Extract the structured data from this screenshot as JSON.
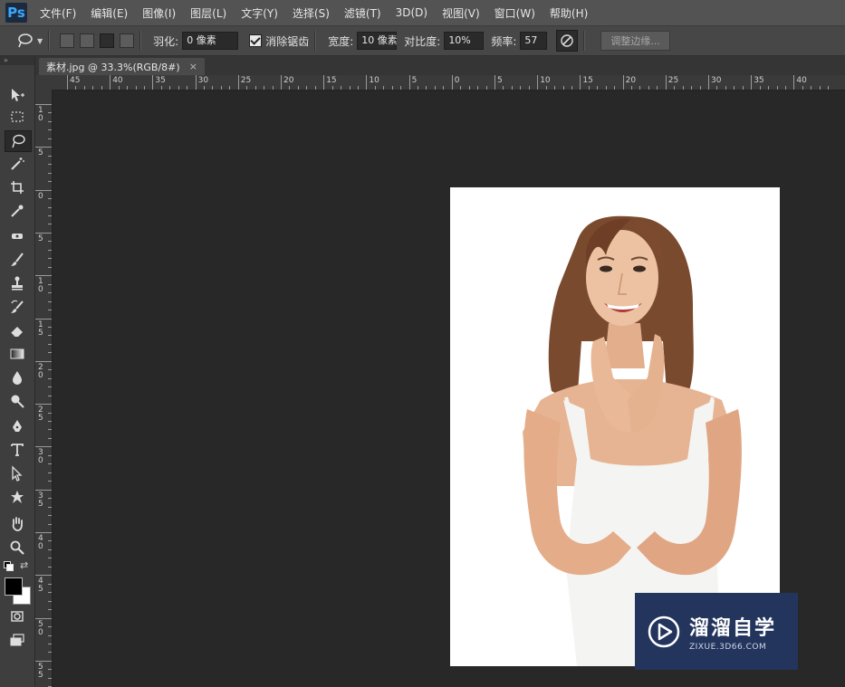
{
  "app": {
    "logo": "Ps"
  },
  "menu": [
    "文件(F)",
    "编辑(E)",
    "图像(I)",
    "图层(L)",
    "文字(Y)",
    "选择(S)",
    "滤镜(T)",
    "3D(D)",
    "视图(V)",
    "窗口(W)",
    "帮助(H)"
  ],
  "options": {
    "feather_label": "羽化:",
    "feather_value": "0 像素",
    "antialias_label": "消除锯齿",
    "antialias_checked": true,
    "width_label": "宽度:",
    "width_value": "10 像素",
    "contrast_label": "对比度:",
    "contrast_value": "10%",
    "frequency_label": "频率:",
    "frequency_value": "57",
    "refine_edge_label": "调整边缘..."
  },
  "document_tab": {
    "title": "素材.jpg @ 33.3%(RGB/8#)",
    "close": "×"
  },
  "ruler_top": [
    "45",
    "40",
    "35",
    "30",
    "25",
    "20",
    "15",
    "10",
    "5",
    "0",
    "5",
    "10",
    "15",
    "20",
    "25",
    "30",
    "35",
    "40"
  ],
  "ruler_left": [
    "1\n0",
    "5",
    "0",
    "5",
    "1\n0",
    "1\n5",
    "2\n0",
    "2\n5",
    "3\n0",
    "3\n5",
    "4\n0",
    "4\n5",
    "5\n0",
    "5\n5"
  ],
  "tools": [
    "move-tool",
    "marquee-tool",
    "magnetic-lasso-tool",
    "magic-wand-tool",
    "crop-tool",
    "eyedropper-tool",
    "spot-healing-tool",
    "brush-tool",
    "stamp-tool",
    "history-brush-tool",
    "eraser-tool",
    "gradient-tool",
    "blur-tool",
    "dodge-tool",
    "pen-tool",
    "type-tool",
    "path-selection-tool",
    "shape-tool",
    "hand-tool",
    "zoom-tool"
  ],
  "colors": {
    "foreground": "#000000",
    "background": "#ffffff",
    "watermark_bg": "#23355c"
  },
  "watermark": {
    "title": "溜溜自学",
    "url": "ZIXUE.3D66.COM"
  }
}
